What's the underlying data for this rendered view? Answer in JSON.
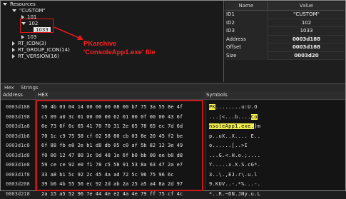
{
  "tree": {
    "root": "Resources",
    "custom": "\"CUSTOM\"",
    "n101": "101",
    "n102": "102",
    "n1033": "1033",
    "n103": "103",
    "rt_icon": "RT_ICON(3)",
    "rt_group_icon": "RT_GROUP_ICON(14)",
    "rt_version": "RT_VERSION(16)"
  },
  "annotation": {
    "line1": "PKarchive",
    "line2": "'ConsoleApp1.exe' file"
  },
  "properties": {
    "header_name": "Name",
    "header_value": "Value",
    "rows": [
      {
        "name": "ID1",
        "value": "\"CUSTOM\""
      },
      {
        "name": "ID2",
        "value": "102"
      },
      {
        "name": "ID3",
        "value": "1033"
      },
      {
        "name": "Address",
        "value": "0003d188"
      },
      {
        "name": "Offset",
        "value": "0003d188"
      },
      {
        "name": "Size",
        "value": "0003d20"
      }
    ]
  },
  "tabs": {
    "hex": "Hex",
    "strings": "Strings"
  },
  "hexview": {
    "addr_header": "Address",
    "hex_header": "HEX",
    "sym_header": "Symbols",
    "addresses": [
      "0003d188",
      "0003d198",
      "0003d1a8",
      "0003d1b8",
      "0003d1c8",
      "0003d1d8",
      "0003d1e8",
      "0003d1f8",
      "0003d208",
      "0003d218"
    ],
    "hex_rows": [
      "50 4b 03 04 14 00 00 00 08 00 b7 75 3a 55 8e 4f",
      "c5 09 a0 3c 01 00 00 00 62 01 00 0f 00 00 43 6f",
      "6e 73 6f 6c 65 41 70 70 31 2e 65 78 65 ec 7d 6d",
      "70 1c c9 75 58 cf 02 58 80 cb 03 8e 20 45 f2 be",
      "6f 88 fb e0 2e b1 d8 db 05 c0 af 5b 82 12 3e 49",
      "f0 00 12 47 80 3c 9d 48 1e 6f b0 bb 00 ee b0 d8",
      "59 ce ce 92 e0 f1 78 c5 58 91 53 8a 63 47 2a e7",
      "33 a8 b1 5c 92 2c 45 4a ad 72 5c 96 75 96 6c",
      "39 b6 4b 55 56 ec 92 2d ab 2a 25 a5 a4 8a 2d 97",
      "2a 15 a5 52 96 7e 44 4e e2 4a 4e 79 ff 75 cf 4c"
    ],
    "sym_rows": [
      {
        "pre": "",
        "hl": "PK",
        "post": "........u:U.O"
      },
      {
        "pre": "...|<...b....",
        "hl": "Co",
        "post": ""
      },
      {
        "pre": "",
        "hl": "nsoleApp1.exe.",
        "post": "}m"
      },
      {
        "pre": "p..uX..X.... E..",
        "hl": "",
        "post": ""
      },
      {
        "pre": "o......[..>I",
        "hl": "",
        "post": ""
      },
      {
        "pre": "...G.<.H.o.;....",
        "hl": "",
        "post": ""
      },
      {
        "pre": "Y.....x.X.S.cG*.",
        "hl": "",
        "post": ""
      },
      {
        "pre": "3..\\.,EJ.r\\.u.l",
        "hl": "",
        "post": ""
      },
      {
        "pre": "9.KUV..-.*%...-.",
        "hl": "",
        "post": ""
      },
      {
        "pre": "*..R.~DN.JNy.u.L",
        "hl": "",
        "post": ""
      }
    ]
  },
  "colors": {
    "annotation": "#ff2020",
    "highlight": "#f2ef4f",
    "box": "#e51a1a"
  }
}
